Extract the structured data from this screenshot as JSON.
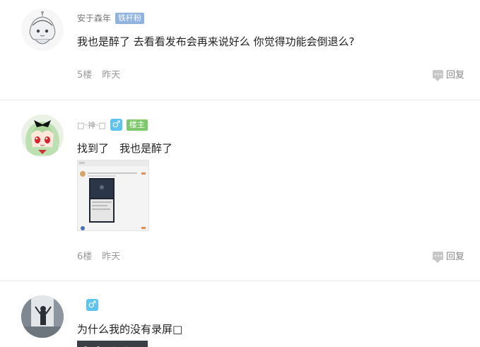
{
  "posts": [
    {
      "username": "安于森年",
      "badge": "铁杆粉",
      "content": "我也是醉了 去看看发布会再来说好么 你觉得功能会倒退么?",
      "floor": "5楼",
      "time": "昨天",
      "reply_label": "回复"
    },
    {
      "username": "□ᵕ神ᵕ□",
      "gender": "♂",
      "badge": "楼主",
      "content": "找到了　我也是醉了",
      "floor": "6楼",
      "time": "昨天",
      "reply_label": "回复"
    },
    {
      "gender": "♂",
      "content": "为什么我的没有录屏□"
    }
  ],
  "colors": {
    "fan_badge": "#8fb2e0",
    "host_badge": "#7cc86b",
    "gender_male": "#5ec3ef"
  }
}
